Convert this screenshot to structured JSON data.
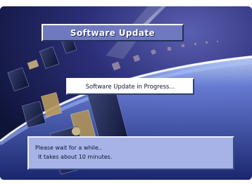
{
  "screen": {
    "title": "Software Update",
    "status": "Software Update in Progress...",
    "message_lines": [
      "Please wait for a while..",
      "It takes about 10 minutes."
    ]
  },
  "colors": {
    "title_box": "#6f79c0",
    "message_box": "#a7b3e6",
    "status_box": "#ffffff",
    "background_space": "#1a2460"
  }
}
